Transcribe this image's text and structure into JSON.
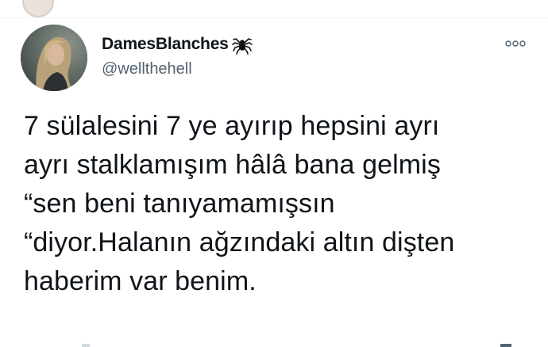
{
  "tweet": {
    "display_name": "DamesBlanches",
    "handle": "@wellthehell",
    "name_emoji_icon": "spider-icon",
    "more_icon": "more-options-icon",
    "text_lines": [
      "7 sülalesini 7 ye ayırıp hepsini ayrı",
      "ayrı stalklamışım hâlâ bana gelmiş",
      "“sen beni tanıyamamışsın",
      "“diyor.Halanın ağzındaki altın dişten",
      "haberim var benim."
    ]
  },
  "colors": {
    "text_primary": "#0f1419",
    "text_secondary": "#536471",
    "divider": "#eff3f4"
  }
}
